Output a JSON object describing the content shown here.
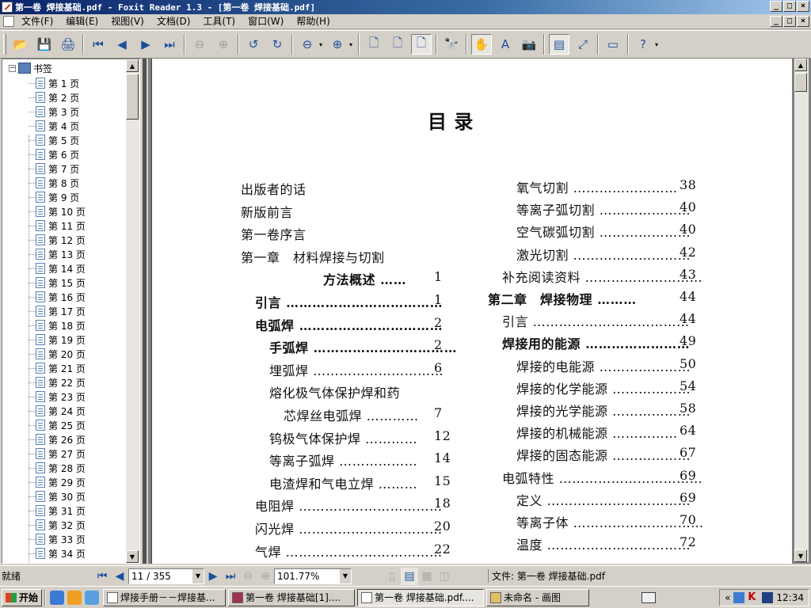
{
  "window": {
    "title": "第一卷 焊接基础.pdf - Foxit Reader 1.3 - [第一卷 焊接基础.pdf]",
    "min": "_",
    "max": "□",
    "close": "×"
  },
  "menu": [
    "文件(F)",
    "编辑(E)",
    "视图(V)",
    "文档(D)",
    "工具(T)",
    "窗口(W)",
    "帮助(H)"
  ],
  "toolbar": [
    {
      "name": "open-icon",
      "glyph": "📂"
    },
    {
      "name": "save-icon",
      "glyph": "💾"
    },
    {
      "name": "print-icon",
      "glyph": "🖨"
    },
    {
      "sep": true
    },
    {
      "name": "first-page-icon",
      "glyph": "⏮"
    },
    {
      "name": "prev-page-icon",
      "glyph": "◀"
    },
    {
      "name": "next-page-icon",
      "glyph": "▶"
    },
    {
      "name": "last-page-icon",
      "glyph": "⏭"
    },
    {
      "sep": true
    },
    {
      "name": "back-icon",
      "glyph": "⊖",
      "dis": true
    },
    {
      "name": "forward-icon",
      "glyph": "⊕",
      "dis": true
    },
    {
      "sep": true
    },
    {
      "name": "rotate-left-icon",
      "glyph": "↺"
    },
    {
      "name": "rotate-right-icon",
      "glyph": "↻"
    },
    {
      "sep": true
    },
    {
      "name": "zoom-out-icon",
      "glyph": "⊖"
    },
    {
      "dd": true
    },
    {
      "name": "zoom-in-icon",
      "glyph": "⊕"
    },
    {
      "dd": true
    },
    {
      "sep": true
    },
    {
      "name": "actual-size-icon",
      "glyph": "🗋"
    },
    {
      "name": "fit-page-icon",
      "glyph": "🗋"
    },
    {
      "name": "fit-width-icon",
      "glyph": "🗋",
      "on": true
    },
    {
      "sep": true
    },
    {
      "name": "find-icon",
      "glyph": "🔭"
    },
    {
      "sep": true
    },
    {
      "name": "hand-tool-icon",
      "glyph": "✋",
      "on": true
    },
    {
      "name": "select-text-icon",
      "glyph": "A"
    },
    {
      "name": "snapshot-icon",
      "glyph": "📷"
    },
    {
      "sep": true
    },
    {
      "name": "bookmarks-panel-icon",
      "glyph": "▤",
      "on": true
    },
    {
      "name": "fullscreen-icon",
      "glyph": "⤢"
    },
    {
      "sep": true
    },
    {
      "name": "comment-icon",
      "glyph": "▭"
    },
    {
      "sep": true
    },
    {
      "name": "help-icon",
      "glyph": "?"
    },
    {
      "dd": true
    }
  ],
  "bookmarks": {
    "root": "书签",
    "pages": [
      "第 1 页",
      "第 2 页",
      "第 3 页",
      "第 4 页",
      "第 5 页",
      "第 6 页",
      "第 7 页",
      "第 8 页",
      "第 9 页",
      "第 10 页",
      "第 11 页",
      "第 12 页",
      "第 13 页",
      "第 14 页",
      "第 15 页",
      "第 16 页",
      "第 17 页",
      "第 18 页",
      "第 19 页",
      "第 20 页",
      "第 21 页",
      "第 22 页",
      "第 23 页",
      "第 24 页",
      "第 25 页",
      "第 26 页",
      "第 27 页",
      "第 28 页",
      "第 29 页",
      "第 30 页",
      "第 31 页",
      "第 32 页",
      "第 33 页",
      "第 34 页"
    ]
  },
  "page": {
    "heading": "目        录",
    "left": [
      {
        "t": "出版者的话",
        "n": "",
        "ind": 0
      },
      {
        "t": "新版前言",
        "n": "",
        "ind": 0
      },
      {
        "t": "第一卷序言",
        "n": "",
        "ind": 0
      },
      {
        "t": "第一章　材料焊接与切割",
        "n": "",
        "ind": 0
      },
      {
        "t": "方法概述 ……",
        "n": "1",
        "ind": 104,
        "b": true
      },
      {
        "t": "引言 ………………………………",
        "n": "1",
        "ind": 18,
        "b": true
      },
      {
        "t": "电弧焊 ……………………………",
        "n": "2",
        "ind": 18,
        "b": true
      },
      {
        "t": "手弧焊 ……………………………",
        "n": "2",
        "ind": 36,
        "b": true
      },
      {
        "t": "埋弧焊 …………………………",
        "n": "6",
        "ind": 36
      },
      {
        "t": "熔化极气体保护焊和药",
        "n": "",
        "ind": 36
      },
      {
        "t": "芯焊丝电弧焊 …………",
        "n": "7",
        "ind": 54
      },
      {
        "t": "钨极气体保护焊 …………",
        "n": "12",
        "ind": 36
      },
      {
        "t": "等离子弧焊 ………………",
        "n": "14",
        "ind": 36
      },
      {
        "t": "电渣焊和气电立焊 ………",
        "n": "15",
        "ind": 36
      },
      {
        "t": "电阻焊 ……………………………",
        "n": "18",
        "ind": 18
      },
      {
        "t": "闪光焊 ……………………………",
        "n": "20",
        "ind": 18
      },
      {
        "t": "气焊 ………………………………",
        "n": "22",
        "ind": 18
      }
    ],
    "right": [
      {
        "t": "氧气切割 ……………………",
        "n": "38",
        "ind": 36
      },
      {
        "t": "等离子弧切割 …………………",
        "n": "40",
        "ind": 36
      },
      {
        "t": "空气碳弧切割 …………………",
        "n": "40",
        "ind": 36
      },
      {
        "t": "激光切割 ………………………",
        "n": "42",
        "ind": 36
      },
      {
        "t": "补充阅读资料 ………………………",
        "n": "43",
        "ind": 18
      },
      {
        "t": "第二章　焊接物理 ………",
        "n": "44",
        "ind": 0,
        "b": true
      },
      {
        "t": "引言 ………………………………",
        "n": "44",
        "ind": 18
      },
      {
        "t": "焊接用的能源 ……………………",
        "n": "49",
        "ind": 18,
        "b": true
      },
      {
        "t": "焊接的电能源 …………………",
        "n": "50",
        "ind": 36
      },
      {
        "t": "焊接的化学能源 ………………",
        "n": "54",
        "ind": 36
      },
      {
        "t": "焊接的光学能源 ………………",
        "n": "58",
        "ind": 36
      },
      {
        "t": "焊接的机械能源 ……………",
        "n": "64",
        "ind": 36
      },
      {
        "t": "焊接的固态能源 ………………",
        "n": "67",
        "ind": 36
      },
      {
        "t": "电弧特性 ……………………………",
        "n": "69",
        "ind": 18
      },
      {
        "t": "定义 ……………………………",
        "n": "69",
        "ind": 36
      },
      {
        "t": "等离子体 …………………………",
        "n": "70",
        "ind": 36
      },
      {
        "t": "温度 ……………………………",
        "n": "72",
        "ind": 36
      }
    ]
  },
  "status": {
    "ready": "就绪",
    "page_field": "11 / 355",
    "zoom": "101.77%",
    "file": "文件: 第一卷 焊接基础.pdf"
  },
  "taskbar": {
    "start": "开始",
    "tasks": [
      {
        "label": "焊接手册－－焊接基...",
        "active": false
      },
      {
        "label": "第一卷 焊接基础[1]....",
        "active": false
      },
      {
        "label": "第一卷 焊接基础.pdf....",
        "active": true
      },
      {
        "label": "未命名 - 画图",
        "active": false
      }
    ],
    "tray_expand": "«",
    "clock": "12:34"
  }
}
